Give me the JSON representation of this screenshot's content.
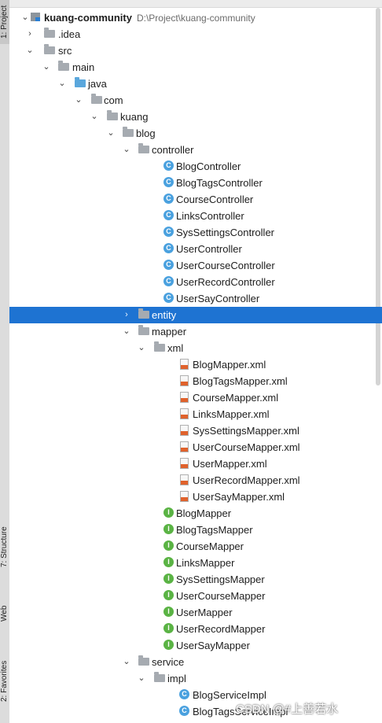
{
  "sidebar": {
    "tabs": [
      {
        "label": "1: Project"
      },
      {
        "label": "7: Structure"
      },
      {
        "label": "Web"
      },
      {
        "label": "2: Favorites"
      }
    ]
  },
  "tree": {
    "root": {
      "name": "kuang-community",
      "path": "D:\\Project\\kuang-community"
    },
    "idea": ".idea",
    "src": "src",
    "main": "main",
    "java": "java",
    "com": "com",
    "kuang": "kuang",
    "blog": "blog",
    "controller": {
      "name": "controller",
      "classes": [
        "BlogController",
        "BlogTagsController",
        "CourseController",
        "LinksController",
        "SysSettingsController",
        "UserController",
        "UserCourseController",
        "UserRecordController",
        "UserSayController"
      ]
    },
    "entity": "entity",
    "mapper": {
      "name": "mapper",
      "xml_folder": "xml",
      "xml_files": [
        "BlogMapper.xml",
        "BlogTagsMapper.xml",
        "CourseMapper.xml",
        "LinksMapper.xml",
        "SysSettingsMapper.xml",
        "UserCourseMapper.xml",
        "UserMapper.xml",
        "UserRecordMapper.xml",
        "UserSayMapper.xml"
      ],
      "interfaces": [
        "BlogMapper",
        "BlogTagsMapper",
        "CourseMapper",
        "LinksMapper",
        "SysSettingsMapper",
        "UserCourseMapper",
        "UserMapper",
        "UserRecordMapper",
        "UserSayMapper"
      ]
    },
    "service": {
      "name": "service",
      "impl_folder": "impl",
      "impl_classes": [
        "BlogServiceImpl",
        "BlogTagsServiceImpl"
      ]
    },
    "selected": "entity"
  },
  "icon_letters": {
    "class": "C",
    "interface": "I"
  },
  "watermark": "CSDN @#上善若水",
  "colors": {
    "selection": "#1e73d2",
    "class_icon": "#4aa1df",
    "interface_icon": "#5ab344",
    "folder": "#a6abb1",
    "source_folder": "#5aa7dc"
  }
}
